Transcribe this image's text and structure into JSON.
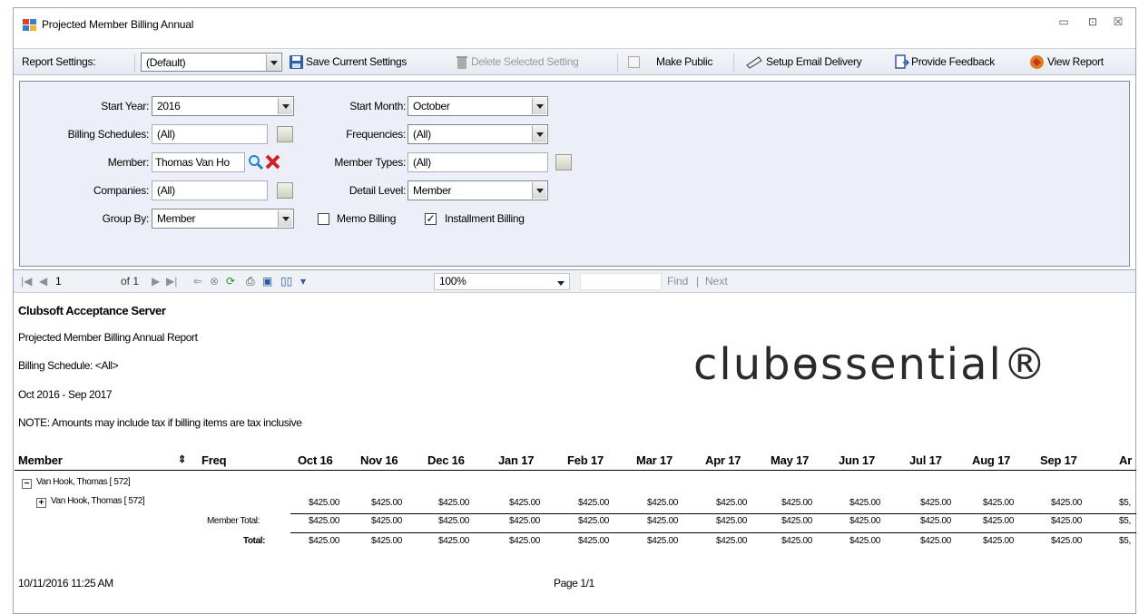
{
  "window": {
    "title": "Projected Member Billing Annual",
    "controls": [
      "▭",
      "⊡",
      "☒"
    ]
  },
  "toolbar": {
    "report_settings_label": "Report Settings:",
    "settings_value": "(Default)",
    "save_label": "Save Current Settings",
    "delete_label": "Delete Selected Setting",
    "make_public_label": "Make Public",
    "email_label": "Setup Email Delivery",
    "feedback_label": "Provide Feedback",
    "view_label": "View Report"
  },
  "params": {
    "start_year_label": "Start Year:",
    "start_year": "2016",
    "start_month_label": "Start Month:",
    "start_month": "October",
    "billing_schedules_label": "Billing Schedules:",
    "billing_schedules": "(All)",
    "frequencies_label": "Frequencies:",
    "frequencies": "(All)",
    "member_label": "Member:",
    "member": "Thomas Van Ho",
    "member_types_label": "Member Types:",
    "member_types": "(All)",
    "companies_label": "Companies:",
    "companies": "(All)",
    "detail_level_label": "Detail Level:",
    "detail_level": "Member",
    "group_by_label": "Group By:",
    "group_by": "Member",
    "memo_billing_label": "Memo Billing",
    "installment_billing_label": "Installment Billing"
  },
  "viewer": {
    "page": "1",
    "of_label": "of 1",
    "zoom": "100%",
    "find_label": "Find",
    "next_label": "Next"
  },
  "report": {
    "server": "Clubsoft Acceptance Server",
    "name": "Projected Member Billing Annual Report",
    "schedule": "Billing Schedule: <All>",
    "period": "Oct 2016 - Sep 2017",
    "note": "NOTE: Amounts may include tax if billing items are tax inclusive",
    "logo_text": "clubɵssential®",
    "col_member": "Member",
    "col_freq": "Freq",
    "months": [
      "Oct 16",
      "Nov 16",
      "Dec 16",
      "Jan 17",
      "Feb 17",
      "Mar 17",
      "Apr 17",
      "May 17",
      "Jun 17",
      "Jul 17",
      "Aug 17",
      "Sep 17",
      "Ar"
    ],
    "group_row": "Van Hook, Thomas [ 572]",
    "member_row": "Van Hook, Thomas [ 572]",
    "member_total_label": "Member Total:",
    "total_label": "Total:",
    "amount": "$425.00",
    "annual": "$5,",
    "footer_date": "10/11/2016 11:25 AM",
    "footer_page": "Page 1/1"
  }
}
